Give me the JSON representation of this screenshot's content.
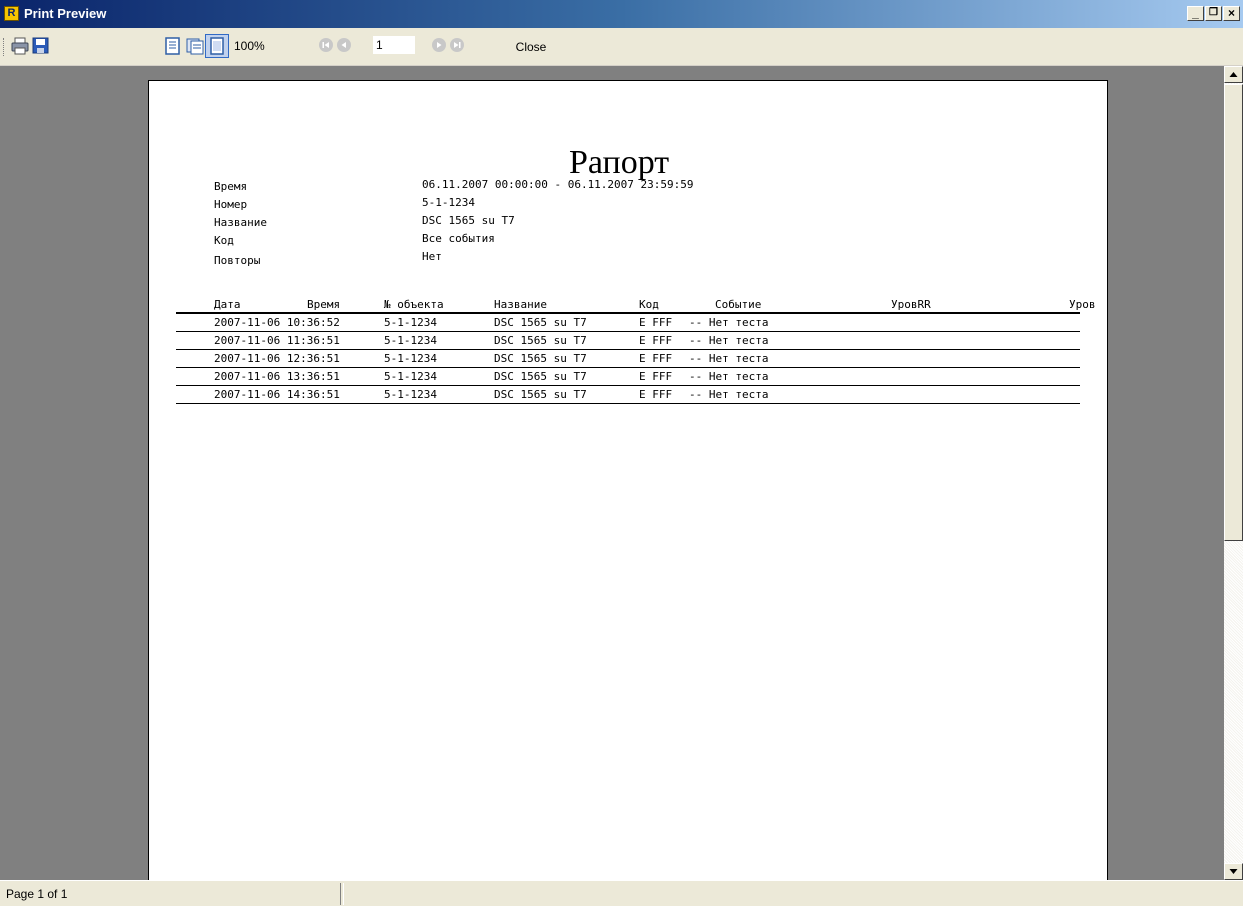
{
  "window": {
    "title": "Print Preview",
    "icon_letter": "R"
  },
  "toolbar": {
    "zoom": "100%",
    "page_number": "1",
    "close_label": "Close"
  },
  "report": {
    "title": "Рапорт",
    "header": [
      {
        "label": "Время",
        "value": "06.11.2007 00:00:00 - 06.11.2007 23:59:59"
      },
      {
        "label": "Номер",
        "value": "5-1-1234"
      },
      {
        "label": "Название",
        "value": "DSC 1565 su T7"
      },
      {
        "label": "Код",
        "value": "Все события"
      },
      {
        "label": "Повторы",
        "value": "Нет"
      }
    ],
    "columns": [
      "Дата",
      "Время",
      "№ объекта",
      "Название",
      "Код",
      "Событие",
      "УровRR",
      "Уров"
    ],
    "rows": [
      {
        "date_time": "2007-11-06 10:36:52",
        "object": "5-1-1234",
        "name": "DSC 1565 su T7",
        "code": "E FFF",
        "event": "-- Нет теста"
      },
      {
        "date_time": "2007-11-06 11:36:51",
        "object": "5-1-1234",
        "name": "DSC 1565 su T7",
        "code": "E FFF",
        "event": "-- Нет теста"
      },
      {
        "date_time": "2007-11-06 12:36:51",
        "object": "5-1-1234",
        "name": "DSC 1565 su T7",
        "code": "E FFF",
        "event": "-- Нет теста"
      },
      {
        "date_time": "2007-11-06 13:36:51",
        "object": "5-1-1234",
        "name": "DSC 1565 su T7",
        "code": "E FFF",
        "event": "-- Нет теста"
      },
      {
        "date_time": "2007-11-06 14:36:51",
        "object": "5-1-1234",
        "name": "DSC 1565 su T7",
        "code": "E FFF",
        "event": "-- Нет теста"
      }
    ]
  },
  "statusbar": {
    "text": "Page 1 of 1"
  },
  "icons": {
    "print": "printer-icon",
    "save": "floppy-disk-icon",
    "single_page": "single-page-icon",
    "two_page": "two-page-icon",
    "full_page": "full-page-icon",
    "first": "first-page-icon",
    "prev": "previous-page-icon",
    "next": "next-page-icon",
    "last": "last-page-icon"
  }
}
